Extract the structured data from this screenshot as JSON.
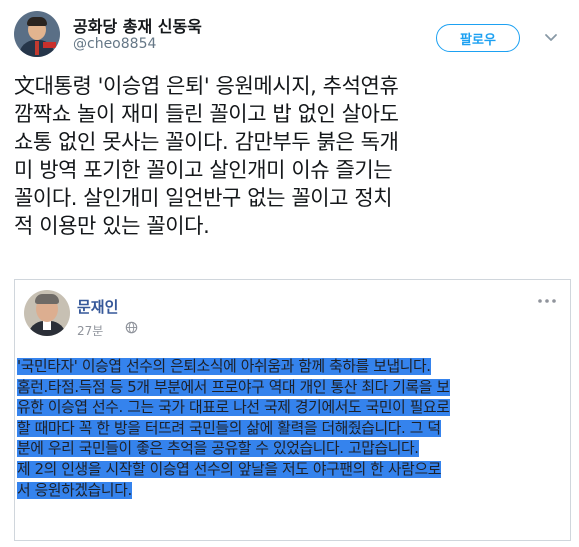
{
  "header": {
    "name": "공화당 총재 신동욱",
    "handle": "@cheo8854",
    "follow_label": "팔로우"
  },
  "tweet": {
    "lines": [
      "文대통령 '이승엽 은퇴' 응원메시지, 추석연휴",
      "깜짝쇼 놀이 재미 들린 꼴이고 밥 없인 살아도",
      "쇼통 없인 못사는 꼴이다. 감만부두 붉은 독개",
      "미 방역 포기한 꼴이고 살인개미 이슈 즐기는",
      "꼴이다. 살인개미 일언반구 없는 꼴이고 정치",
      "적 이용만 있는 꼴이다."
    ]
  },
  "embedded_post": {
    "author": "문재인",
    "time": "27분",
    "globe_icon": "globe-icon",
    "more_icon": "more-options-icon",
    "highlight_color": "#3583ed",
    "lines": [
      "'국민타자' 이승엽 선수의 은퇴소식에 아쉬움과 함께 축하를 보냅니다.",
      "홈런.타점.득점 등 5개 부분에서 프로야구 역대 개인 통산 최다 기록을 보",
      "유한 이승엽 선수. 그는 국가 대표로 나선 국제 경기에서도 국민이 필요로",
      "할 때마다 꼭 한 방을 터뜨려 국민들의 삶에 활력을 더해줬습니다. 그 덕",
      "분에 우리 국민들이 좋은 추억을 공유할 수 있었습니다. 고맙습니다.",
      "제 2의 인생을 시작할 이승엽 선수의 앞날을 저도 야구팬의 한 사람으로",
      "서 응원하겠습니다."
    ]
  }
}
